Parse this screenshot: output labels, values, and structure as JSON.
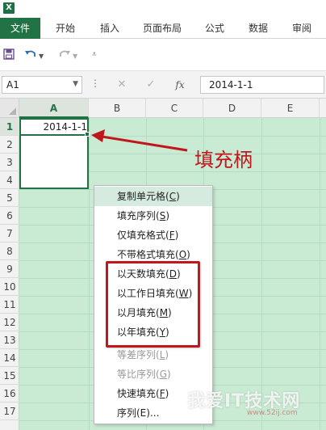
{
  "app": {
    "icon_label": "X",
    "brand_color": "#217346"
  },
  "ribbon": {
    "tabs": [
      "文件",
      "开始",
      "插入",
      "页面布局",
      "公式",
      "数据",
      "审阅"
    ],
    "active_tab": "文件"
  },
  "qat": {
    "save_icon": "save-icon",
    "undo_icon": "undo-icon",
    "redo_icon": "redo-icon"
  },
  "formula_bar": {
    "name_box": "A1",
    "cancel_symbol": "✕",
    "enter_symbol": "✓",
    "fx_label": "fx",
    "formula": "2014-1-1"
  },
  "grid": {
    "columns": [
      "A",
      "B",
      "C",
      "D",
      "E"
    ],
    "rows": [
      "1",
      "2",
      "3",
      "4",
      "5",
      "6",
      "7",
      "8",
      "9",
      "10",
      "11",
      "12",
      "13",
      "14",
      "15",
      "16",
      "17"
    ],
    "selected_column": "A",
    "selected_row": "1",
    "cell_a1": "2014-1-1",
    "background_color": "#c9ead3"
  },
  "annotation": {
    "label": "填充柄",
    "color": "#c0161c"
  },
  "context_menu": {
    "items": [
      {
        "label": "复制单元格",
        "key": "C",
        "state": "highlighted"
      },
      {
        "label": "填充序列",
        "key": "S",
        "state": "normal"
      },
      {
        "label": "仅填充格式",
        "key": "F",
        "state": "normal"
      },
      {
        "label": "不带格式填充",
        "key": "O",
        "state": "normal"
      },
      {
        "label": "以天数填充",
        "key": "D",
        "state": "normal"
      },
      {
        "label": "以工作日填充",
        "key": "W",
        "state": "normal"
      },
      {
        "label": "以月填充",
        "key": "M",
        "state": "normal"
      },
      {
        "label": "以年填充",
        "key": "Y",
        "state": "normal"
      },
      {
        "label": "等差序列",
        "key": "L",
        "state": "disabled"
      },
      {
        "label": "等比序列",
        "key": "G",
        "state": "disabled"
      },
      {
        "label": "快速填充",
        "key": "F",
        "state": "normal"
      },
      {
        "label": "序列(E)...",
        "key": "",
        "state": "normal"
      }
    ]
  },
  "watermark": {
    "main": "我爱IT技术网",
    "sub": "www.52ij.com"
  }
}
